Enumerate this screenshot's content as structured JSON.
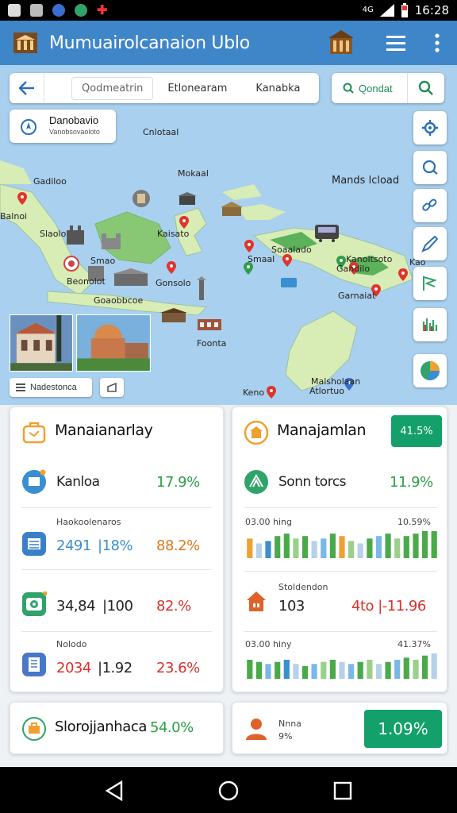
{
  "status_bar": {
    "signal": "4G",
    "time": "16:28"
  },
  "app_bar": {
    "title": "Mumuairolcanaion Ublo"
  },
  "search": {
    "tabs": [
      "Qodmeatrin",
      "Etlonearam",
      "Kanabka"
    ],
    "go_label": "Qondat"
  },
  "location_chip": {
    "title": "Danobavio",
    "subtitle": "Vanobsovaoloto"
  },
  "map_labels": [
    "Cnlotaal",
    "Mokaal",
    "Mands lcload",
    "Gadiloo",
    "Slaolo",
    "Kaisato",
    "Smaal",
    "Kanoltsoto",
    "Gonsolo",
    "Garnaiat",
    "Goaobbcoe",
    "Smao",
    "Soaalado",
    "Beonolot",
    "Gandilo",
    "Foonta",
    "Malsholaan",
    "Atlortuo",
    "Keno",
    "Balnoi",
    "Kao"
  ],
  "map_footer": {
    "chip_label": "Nadestonca"
  },
  "card_left": {
    "title": "Manaianarlay",
    "row1": {
      "name": "Kanloa",
      "value": "17.9%"
    },
    "section_label": "Haokoolenaros",
    "row2": {
      "value_a": "2491",
      "value_b": "|18%",
      "value_c": "88.2%"
    },
    "row3": {
      "value_a": "34,84",
      "value_b": "|100",
      "value_c": "82.%"
    },
    "section2_label": "Nolodo",
    "row4": {
      "value_a": "2034",
      "value_b": "|1.92",
      "value_c": "23.6%"
    }
  },
  "card_right": {
    "title": "Manajamlan",
    "badge": "41.5%",
    "row1": {
      "name": "Sonn torcs",
      "value": "11.9%"
    },
    "chart1": {
      "left_label": "03.00  hing",
      "right_label": "10.59%"
    },
    "section_label": "Stoldendon",
    "row2": {
      "value_a": "103",
      "value_b": "4to |-11.96"
    },
    "chart2": {
      "left_label": "03.00  hiny",
      "right_label": "41.37%"
    }
  },
  "card_bottom_left": {
    "title": "Slorojjanhaca",
    "value": "54.0%"
  },
  "card_bottom_right": {
    "label_a": "Nnna",
    "label_b": "9%",
    "badge": "1.09%"
  },
  "chart_data": [
    {
      "type": "bar",
      "values": [
        8,
        6,
        7,
        9,
        10,
        8,
        9,
        7,
        8,
        10,
        9,
        7,
        6,
        8,
        9,
        10,
        8,
        9,
        10,
        11,
        11
      ]
    },
    {
      "type": "bar",
      "values": [
        9,
        8,
        7,
        8,
        9,
        7,
        6,
        7,
        8,
        9,
        8,
        7,
        8,
        9,
        7,
        8,
        9,
        10,
        9,
        11,
        12
      ]
    }
  ],
  "colors": {
    "appbar": "#3f86c8",
    "accent_green": "#13a06a",
    "land": "#cfe6a8",
    "sea": "#a9d0ee"
  }
}
